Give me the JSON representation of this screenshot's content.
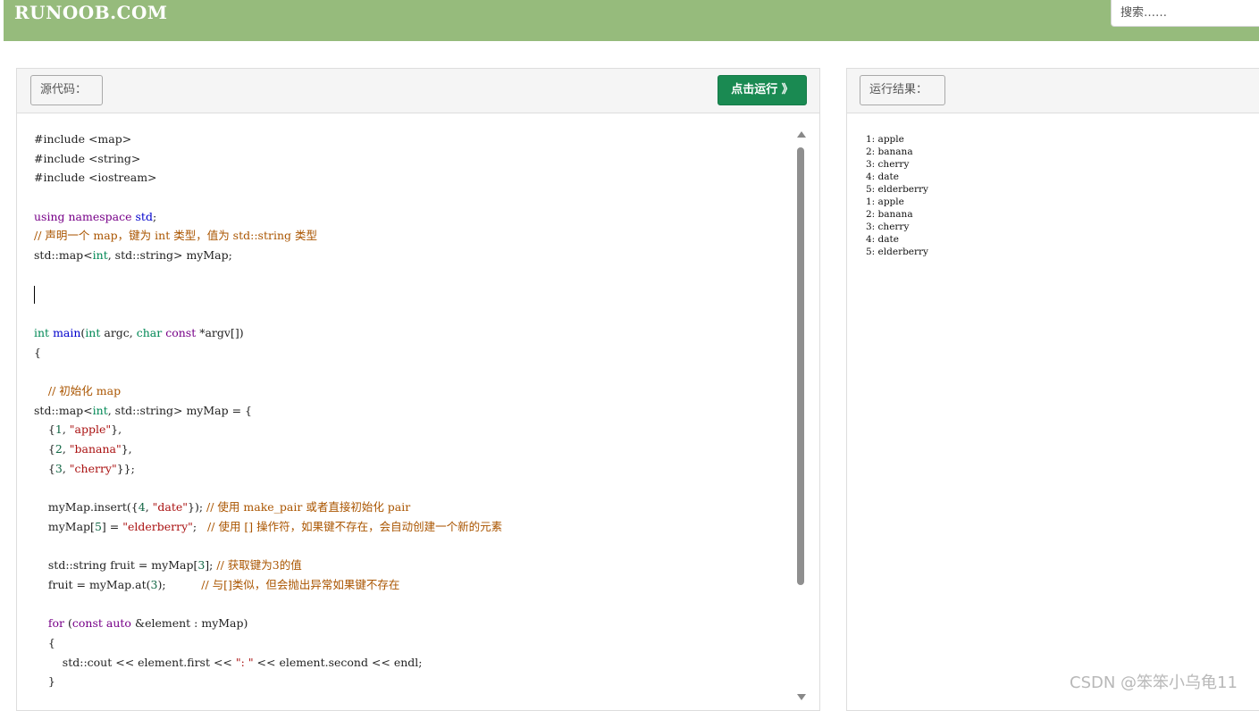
{
  "header": {
    "logo": "RUNOOB.COM",
    "search_placeholder": "搜索……"
  },
  "editor": {
    "label": "源代码：",
    "run_button": "点击运行 》",
    "lines": [
      [
        {
          "t": "#include <map>",
          "c": ""
        }
      ],
      [
        {
          "t": "#include <string>",
          "c": ""
        }
      ],
      [
        {
          "t": "#include <iostream>",
          "c": ""
        }
      ],
      [],
      [
        {
          "t": "using",
          "c": "kw"
        },
        {
          "t": " ",
          "c": ""
        },
        {
          "t": "namespace",
          "c": "kw"
        },
        {
          "t": " ",
          "c": ""
        },
        {
          "t": "std",
          "c": "fn"
        },
        {
          "t": ";",
          "c": ""
        }
      ],
      [
        {
          "t": "// 声明一个 map，键为 int 类型，值为 std::string 类型",
          "c": "cm"
        }
      ],
      [
        {
          "t": "std::map<",
          "c": ""
        },
        {
          "t": "int",
          "c": "ty"
        },
        {
          "t": ", std::string> myMap;",
          "c": ""
        }
      ],
      [],
      [
        {
          "t": "",
          "c": "cursor"
        }
      ],
      [],
      [
        {
          "t": "int",
          "c": "ty"
        },
        {
          "t": " ",
          "c": ""
        },
        {
          "t": "main",
          "c": "fn"
        },
        {
          "t": "(",
          "c": ""
        },
        {
          "t": "int",
          "c": "ty"
        },
        {
          "t": " argc, ",
          "c": ""
        },
        {
          "t": "char",
          "c": "ty"
        },
        {
          "t": " ",
          "c": ""
        },
        {
          "t": "const",
          "c": "kw"
        },
        {
          "t": " *argv[])",
          "c": ""
        }
      ],
      [
        {
          "t": "{",
          "c": ""
        }
      ],
      [],
      [
        {
          "t": "    ",
          "c": ""
        },
        {
          "t": "// 初始化 map",
          "c": "cm"
        }
      ],
      [
        {
          "t": "std::map<",
          "c": ""
        },
        {
          "t": "int",
          "c": "ty"
        },
        {
          "t": ", std::string> myMap = {",
          "c": ""
        }
      ],
      [
        {
          "t": "    {",
          "c": ""
        },
        {
          "t": "1",
          "c": "nu"
        },
        {
          "t": ", ",
          "c": ""
        },
        {
          "t": "\"apple\"",
          "c": "st"
        },
        {
          "t": "},",
          "c": ""
        }
      ],
      [
        {
          "t": "    {",
          "c": ""
        },
        {
          "t": "2",
          "c": "nu"
        },
        {
          "t": ", ",
          "c": ""
        },
        {
          "t": "\"banana\"",
          "c": "st"
        },
        {
          "t": "},",
          "c": ""
        }
      ],
      [
        {
          "t": "    {",
          "c": ""
        },
        {
          "t": "3",
          "c": "nu"
        },
        {
          "t": ", ",
          "c": ""
        },
        {
          "t": "\"cherry\"",
          "c": "st"
        },
        {
          "t": "}};",
          "c": ""
        }
      ],
      [],
      [
        {
          "t": "    myMap.insert({",
          "c": ""
        },
        {
          "t": "4",
          "c": "nu"
        },
        {
          "t": ", ",
          "c": ""
        },
        {
          "t": "\"date\"",
          "c": "st"
        },
        {
          "t": "}); ",
          "c": ""
        },
        {
          "t": "// 使用 make_pair 或者直接初始化 pair",
          "c": "cm"
        }
      ],
      [
        {
          "t": "    myMap[",
          "c": ""
        },
        {
          "t": "5",
          "c": "nu"
        },
        {
          "t": "] = ",
          "c": ""
        },
        {
          "t": "\"elderberry\"",
          "c": "st"
        },
        {
          "t": ";   ",
          "c": ""
        },
        {
          "t": "// 使用 [] 操作符，如果键不存在，会自动创建一个新的元素",
          "c": "cm"
        }
      ],
      [],
      [
        {
          "t": "    std::string fruit = myMap[",
          "c": ""
        },
        {
          "t": "3",
          "c": "nu"
        },
        {
          "t": "]; ",
          "c": ""
        },
        {
          "t": "// 获取键为3的值",
          "c": "cm"
        }
      ],
      [
        {
          "t": "    fruit = myMap.at(",
          "c": ""
        },
        {
          "t": "3",
          "c": "nu"
        },
        {
          "t": ");          ",
          "c": ""
        },
        {
          "t": "// 与[]类似，但会抛出异常如果键不存在",
          "c": "cm"
        }
      ],
      [],
      [
        {
          "t": "    ",
          "c": ""
        },
        {
          "t": "for",
          "c": "kw"
        },
        {
          "t": " (",
          "c": ""
        },
        {
          "t": "const",
          "c": "kw"
        },
        {
          "t": " ",
          "c": ""
        },
        {
          "t": "auto",
          "c": "kw"
        },
        {
          "t": " &element : myMap)",
          "c": ""
        }
      ],
      [
        {
          "t": "    {",
          "c": ""
        }
      ],
      [
        {
          "t": "        std::cout << element.first << ",
          "c": ""
        },
        {
          "t": "\": \"",
          "c": "st"
        },
        {
          "t": " << element.second << endl;",
          "c": ""
        }
      ],
      [
        {
          "t": "    }",
          "c": ""
        }
      ]
    ]
  },
  "result": {
    "label": "运行结果：",
    "lines": [
      "1: apple",
      "2: banana",
      "3: cherry",
      "4: date",
      "5: elderberry",
      "1: apple",
      "2: banana",
      "3: cherry",
      "4: date",
      "5: elderberry"
    ]
  },
  "watermark": "CSDN @笨笨小乌龟11"
}
